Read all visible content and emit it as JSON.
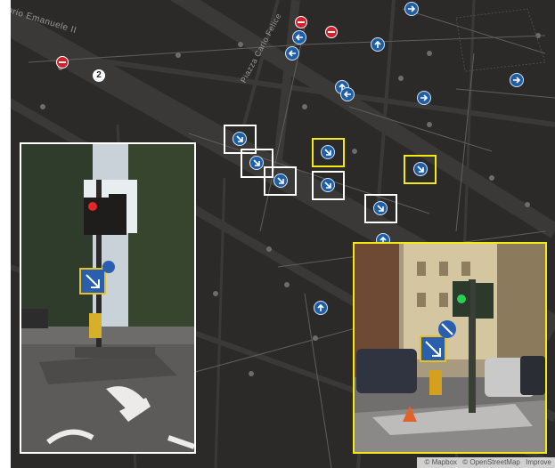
{
  "map": {
    "street_labels": [
      "orio Emanuele II",
      "Piazza Carlo Felice"
    ],
    "cluster_count": "2",
    "colors": {
      "background": "#2b2a29",
      "road": "#3b3a38",
      "marker": "#1f5fa6",
      "selected": "#f4ea13",
      "unselected": "#ffffff",
      "no_entry": "#d4202a"
    },
    "icons": [
      "arrow-right-icon",
      "arrow-left-icon",
      "arrow-up-icon",
      "arrow-down-right-icon",
      "no-entry-icon"
    ]
  },
  "attribution": {
    "mapbox": "© Mapbox",
    "osm": "© OpenStreetMap",
    "improve": "Improve"
  },
  "panels": {
    "left": {
      "type": "street-level photo",
      "highlight": "yellow"
    },
    "right": {
      "type": "street-level photo",
      "highlight": "yellow"
    }
  }
}
